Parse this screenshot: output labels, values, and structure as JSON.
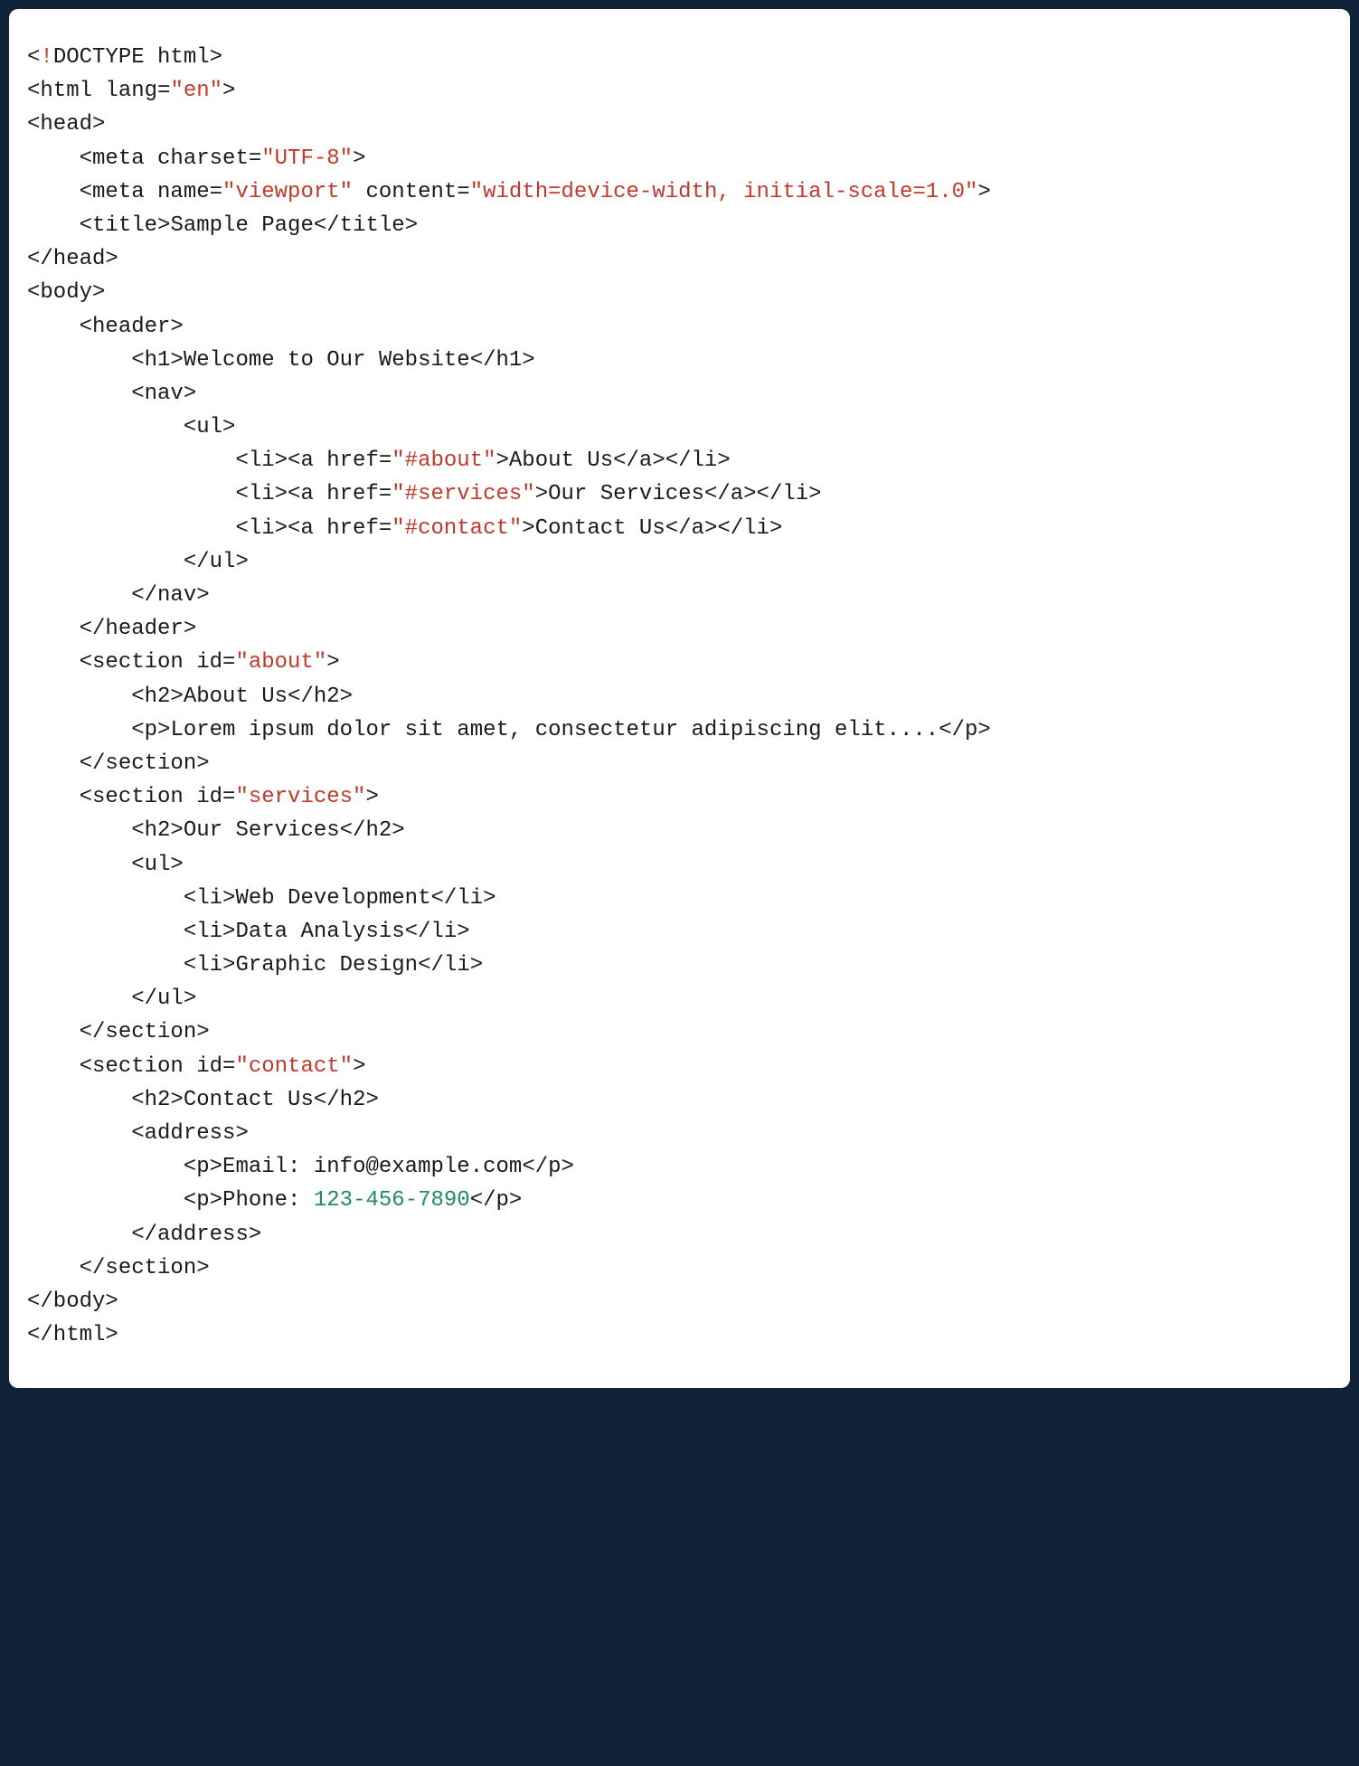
{
  "code": {
    "doctype_open": "<",
    "doctype_bang": "!",
    "doctype_rest": "DOCTYPE html>",
    "html_open": "<html lang=",
    "lang_val": "\"en\"",
    "html_open_end": ">",
    "head_open": "<head>",
    "meta_charset_a": "    <meta charset=",
    "meta_charset_v": "\"UTF-8\"",
    "meta_charset_b": ">",
    "meta_vp_a": "    <meta name=",
    "meta_vp_name": "\"viewport\"",
    "meta_vp_b": " content=",
    "meta_vp_content": "\"width=device-width, initial-scale=1.0\"",
    "meta_vp_c": ">",
    "title_a": "    <title>",
    "title_txt": "Sample Page",
    "title_b": "</title>",
    "head_close": "</head>",
    "body_open": "<body>",
    "header_open": "    <header>",
    "h1_a": "        <h1>",
    "h1_txt": "Welcome to Our Website",
    "h1_b": "</h1>",
    "nav_open": "        <nav>",
    "ul_open": "            <ul>",
    "li1_a": "                <li><a href=",
    "li1_href": "\"#about\"",
    "li1_b": ">",
    "li1_txt": "About Us",
    "li1_c": "</a></li>",
    "li2_a": "                <li><a href=",
    "li2_href": "\"#services\"",
    "li2_b": ">",
    "li2_txt": "Our Services",
    "li2_c": "</a></li>",
    "li3_a": "                <li><a href=",
    "li3_href": "\"#contact\"",
    "li3_b": ">",
    "li3_txt": "Contact Us",
    "li3_c": "</a></li>",
    "ul_close": "            </ul>",
    "nav_close": "        </nav>",
    "header_close": "    </header>",
    "sec_about_a": "    <section id=",
    "sec_about_id": "\"about\"",
    "sec_about_b": ">",
    "about_h2_a": "        <h2>",
    "about_h2_txt": "About Us",
    "about_h2_b": "</h2>",
    "about_p_a": "        <p>",
    "about_p_txt": "Lorem ipsum dolor sit amet, consectetur adipiscing elit....",
    "about_p_b": "</p>",
    "sec_about_close": "    </section>",
    "sec_serv_a": "    <section id=",
    "sec_serv_id": "\"services\"",
    "sec_serv_b": ">",
    "serv_h2_a": "        <h2>",
    "serv_h2_txt": "Our Services",
    "serv_h2_b": "</h2>",
    "serv_ul_open": "        <ul>",
    "serv_li1_a": "            <li>",
    "serv_li1_txt": "Web Development",
    "serv_li1_b": "</li>",
    "serv_li2_a": "            <li>",
    "serv_li2_txt": "Data Analysis",
    "serv_li2_b": "</li>",
    "serv_li3_a": "            <li>",
    "serv_li3_txt": "Graphic Design",
    "serv_li3_b": "</li>",
    "serv_ul_close": "        </ul>",
    "sec_serv_close": "    </section>",
    "sec_con_a": "    <section id=",
    "sec_con_id": "\"contact\"",
    "sec_con_b": ">",
    "con_h2_a": "        <h2>",
    "con_h2_txt": "Contact Us",
    "con_h2_b": "</h2>",
    "addr_open": "        <address>",
    "email_a": "            <p>",
    "email_txt": "Email: info@example.com",
    "email_b": "</p>",
    "phone_a": "            <p>",
    "phone_label": "Phone: ",
    "phone_num": "123-456-7890",
    "phone_b": "</p>",
    "addr_close": "        </address>",
    "sec_con_close": "    </section>",
    "body_close": "</body>",
    "html_close": "</html>"
  }
}
